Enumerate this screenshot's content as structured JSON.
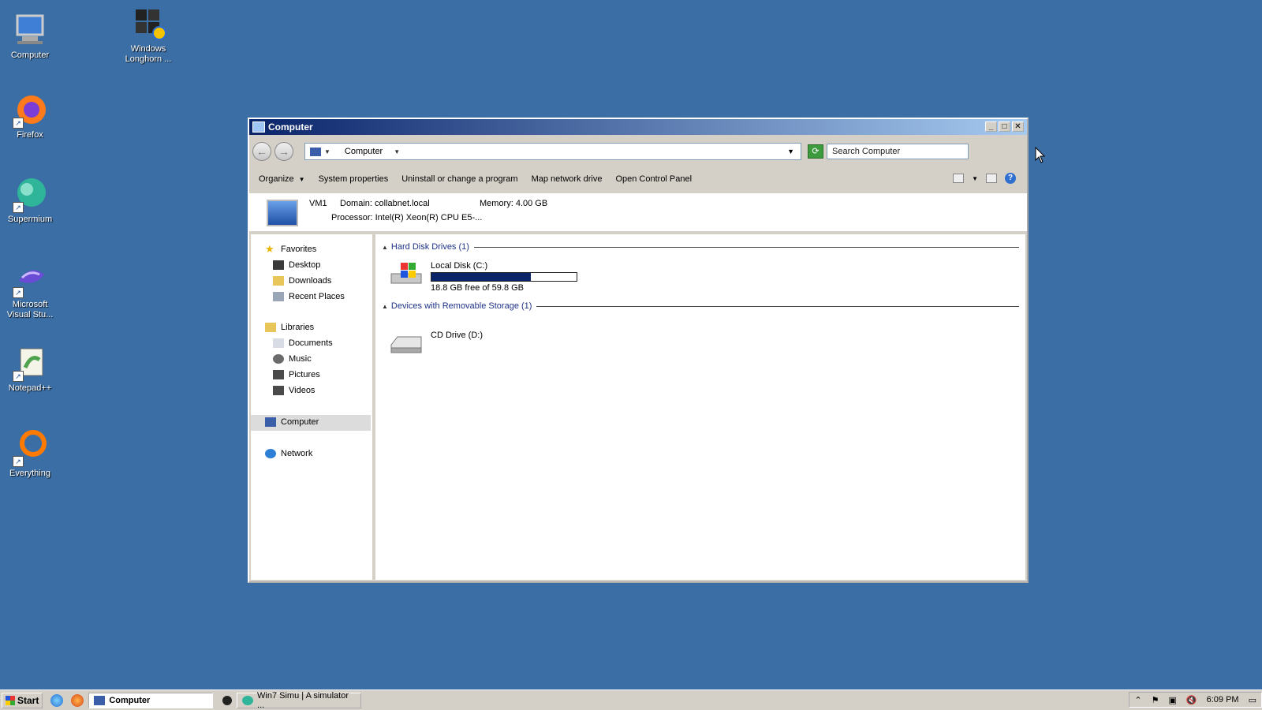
{
  "desktop": {
    "icons": [
      {
        "label": "Computer",
        "icon": "computer-icon"
      },
      {
        "label": "Windows Longhorn ...",
        "icon": "windows-logo-icon"
      },
      {
        "label": "Firefox",
        "icon": "firefox-icon"
      },
      {
        "label": "Supermium",
        "icon": "supermium-icon"
      },
      {
        "label": "Microsoft Visual Stu...",
        "icon": "visual-studio-icon"
      },
      {
        "label": "Notepad++",
        "icon": "notepadpp-icon"
      },
      {
        "label": "Everything",
        "icon": "everything-icon"
      }
    ]
  },
  "window": {
    "title": "Computer",
    "controls": {
      "minimize": "_",
      "maximize": "□",
      "close": "✕"
    },
    "address": {
      "crumb": "Computer"
    },
    "search": {
      "placeholder": "Search Computer"
    },
    "commands": [
      {
        "label": "Organize",
        "has_dropdown": true
      },
      {
        "label": "System properties"
      },
      {
        "label": "Uninstall or change a program"
      },
      {
        "label": "Map network drive"
      },
      {
        "label": "Open Control Panel"
      }
    ],
    "details": {
      "name": "VM1",
      "domain": "Domain: collabnet.local",
      "memory": "Memory: 4.00 GB",
      "processor": "Processor: Intel(R) Xeon(R) CPU E5-..."
    },
    "nav": {
      "favorites": "Favorites",
      "fav_items": [
        "Desktop",
        "Downloads",
        "Recent Places"
      ],
      "libraries": "Libraries",
      "lib_items": [
        "Documents",
        "Music",
        "Pictures",
        "Videos"
      ],
      "computer": "Computer",
      "network": "Network"
    },
    "groups": {
      "hdd": "Hard Disk Drives (1)",
      "removable": "Devices with Removable Storage (1)"
    },
    "drives": {
      "c": {
        "name": "Local Disk (C:)",
        "free": "18.8 GB free of 59.8 GB",
        "used_fraction": 0.686
      },
      "d": {
        "name": "CD Drive (D:)"
      }
    }
  },
  "taskbar": {
    "start": "Start",
    "tasks": [
      {
        "label": "Computer",
        "active": true
      },
      {
        "label": "Win7 Simu | A simulator ...",
        "active": false
      }
    ],
    "clock": "6:09 PM"
  },
  "colors": {
    "desktop": "#3b6ea5",
    "title_start": "#0a246a",
    "title_end": "#a6caf0",
    "disk_fill": "#0a246a"
  }
}
